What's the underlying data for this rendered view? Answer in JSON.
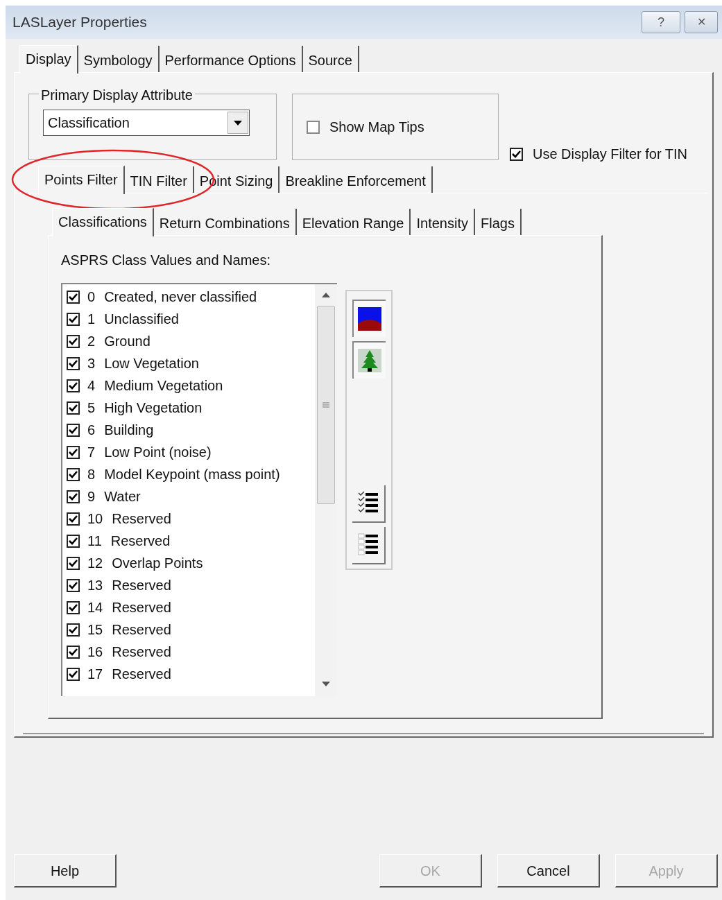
{
  "window": {
    "title": "LASLayer Properties",
    "controls": [
      {
        "kind": "help",
        "label": "?"
      },
      {
        "kind": "close",
        "label": "✕"
      }
    ]
  },
  "tabs": [
    {
      "label": "Display",
      "selected": true
    },
    {
      "label": "Symbology",
      "selected": false
    },
    {
      "label": "Performance Options",
      "selected": false
    },
    {
      "label": "Source",
      "selected": false
    }
  ],
  "primary_display_attribute": {
    "legend": "Primary Display Attribute",
    "value": "Classification"
  },
  "show_map_tips": {
    "label": "Show Map Tips",
    "checked": false
  },
  "use_display_filter_for_tin": {
    "label": "Use Display Filter for TIN",
    "checked": true
  },
  "filter_tabs": [
    {
      "label": "Points Filter",
      "selected": true
    },
    {
      "label": "TIN Filter",
      "selected": false
    },
    {
      "label": "Point Sizing",
      "selected": false
    },
    {
      "label": "Breakline Enforcement",
      "selected": false
    }
  ],
  "annotation": {
    "kind": "ellipse",
    "color": "#e0262a"
  },
  "sub_tabs": [
    {
      "label": "Classifications",
      "selected": true
    },
    {
      "label": "Return Combinations",
      "selected": false
    },
    {
      "label": "Elevation Range",
      "selected": false
    },
    {
      "label": "Intensity",
      "selected": false
    },
    {
      "label": "Flags",
      "selected": false
    }
  ],
  "class_list": {
    "heading": "ASPRS Class Values and Names:",
    "items": [
      {
        "value": "0",
        "name": "Created, never classified",
        "checked": true
      },
      {
        "value": "1",
        "name": "Unclassified",
        "checked": true
      },
      {
        "value": "2",
        "name": "Ground",
        "checked": true
      },
      {
        "value": "3",
        "name": "Low Vegetation",
        "checked": true
      },
      {
        "value": "4",
        "name": "Medium Vegetation",
        "checked": true
      },
      {
        "value": "5",
        "name": "High Vegetation",
        "checked": true
      },
      {
        "value": "6",
        "name": "Building",
        "checked": true
      },
      {
        "value": "7",
        "name": "Low Point (noise)",
        "checked": true
      },
      {
        "value": "8",
        "name": "Model Keypoint (mass point)",
        "checked": true
      },
      {
        "value": "9",
        "name": "Water",
        "checked": true
      },
      {
        "value": "10",
        "name": "Reserved",
        "checked": true
      },
      {
        "value": "11",
        "name": "Reserved",
        "checked": true
      },
      {
        "value": "12",
        "name": "Overlap Points",
        "checked": true
      },
      {
        "value": "13",
        "name": "Reserved",
        "checked": true
      },
      {
        "value": "14",
        "name": "Reserved",
        "checked": true
      },
      {
        "value": "15",
        "name": "Reserved",
        "checked": true
      },
      {
        "value": "16",
        "name": "Reserved",
        "checked": true
      },
      {
        "value": "17",
        "name": "Reserved",
        "checked": true
      }
    ]
  },
  "tool_buttons": [
    {
      "kind": "ground"
    },
    {
      "kind": "vegetation"
    },
    {
      "kind": "select_all"
    },
    {
      "kind": "clear_all"
    }
  ],
  "buttons": [
    {
      "label": "Help",
      "disabled": false
    },
    {
      "label": "OK",
      "disabled": true
    },
    {
      "label": "Cancel",
      "disabled": false
    },
    {
      "label": "Apply",
      "disabled": true
    }
  ]
}
